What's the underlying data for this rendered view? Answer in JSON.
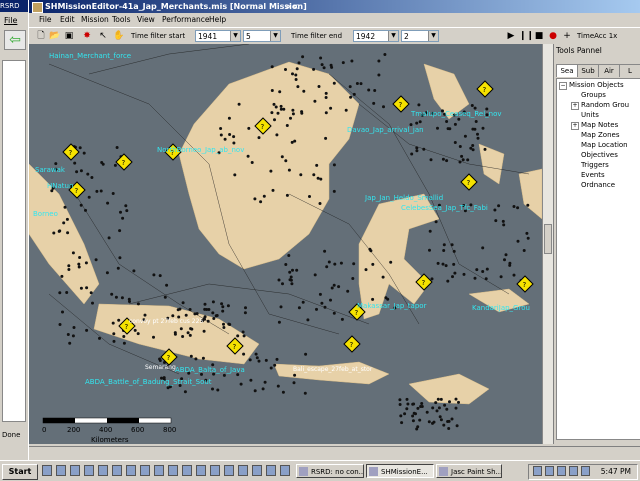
{
  "background_app": {
    "title": "RSRD",
    "menu_file": "File",
    "status_done": "Done"
  },
  "window": {
    "title": "SHMissionEditor-41a_Jap_Merchants.mis [Normal Mission]",
    "title_suffix": "><"
  },
  "menu": [
    "File",
    "Edit",
    "Mission",
    "Tools",
    "View",
    "Performance",
    "Help"
  ],
  "toolbar": {
    "filter_start_label": "Time filter start",
    "filter_start_year": "1941",
    "filter_start_month": "5",
    "filter_end_label": "Time filter end",
    "filter_end_year": "1942",
    "filter_end_month": "2",
    "time_acc": "TimeAcc 1x"
  },
  "tools_panel": {
    "title": "Tools Pannel",
    "tabs": [
      "Sea",
      "Sub",
      "Air",
      "L"
    ],
    "tree_root": "Mission Objects",
    "tree_items": [
      "Groups",
      "Random Grou",
      "Units",
      "Map Notes",
      "Map Zones",
      "Map Location",
      "Objectives",
      "Triggers",
      "Events",
      "Ordnance"
    ]
  },
  "map": {
    "labels": [
      "Hainan_Merchant_force",
      "Sarawak",
      "HNatun",
      "Borneo",
      "NorthBorneo_Jap_ab_nov",
      "Davao_Jap_arrival_jan",
      "Tmalupo_Ceaseq_Rel_nov",
      "Jap_Jan_Heldo_Smallid",
      "CelebesSea_Jap_Tfc_Fabi",
      "convoy pt 27feb cus 225",
      "Semarang",
      "ABDA_Battle_of_Badung_Strait_Sout",
      "Makassar_Jap_tapor",
      "Bali_escape_27feb_at_stor",
      "KandariJap_Grou",
      "ABDA_Balta_of_Java"
    ],
    "scale_labels": [
      "0",
      "200",
      "400",
      "600",
      "800"
    ],
    "scale_unit": "Kilometers"
  },
  "taskbar": {
    "start": "Start",
    "tasks": [
      "RSRD: no con...",
      "SHMissionE...",
      "Jasc Paint Sh..."
    ],
    "clock": "5:47 PM"
  }
}
